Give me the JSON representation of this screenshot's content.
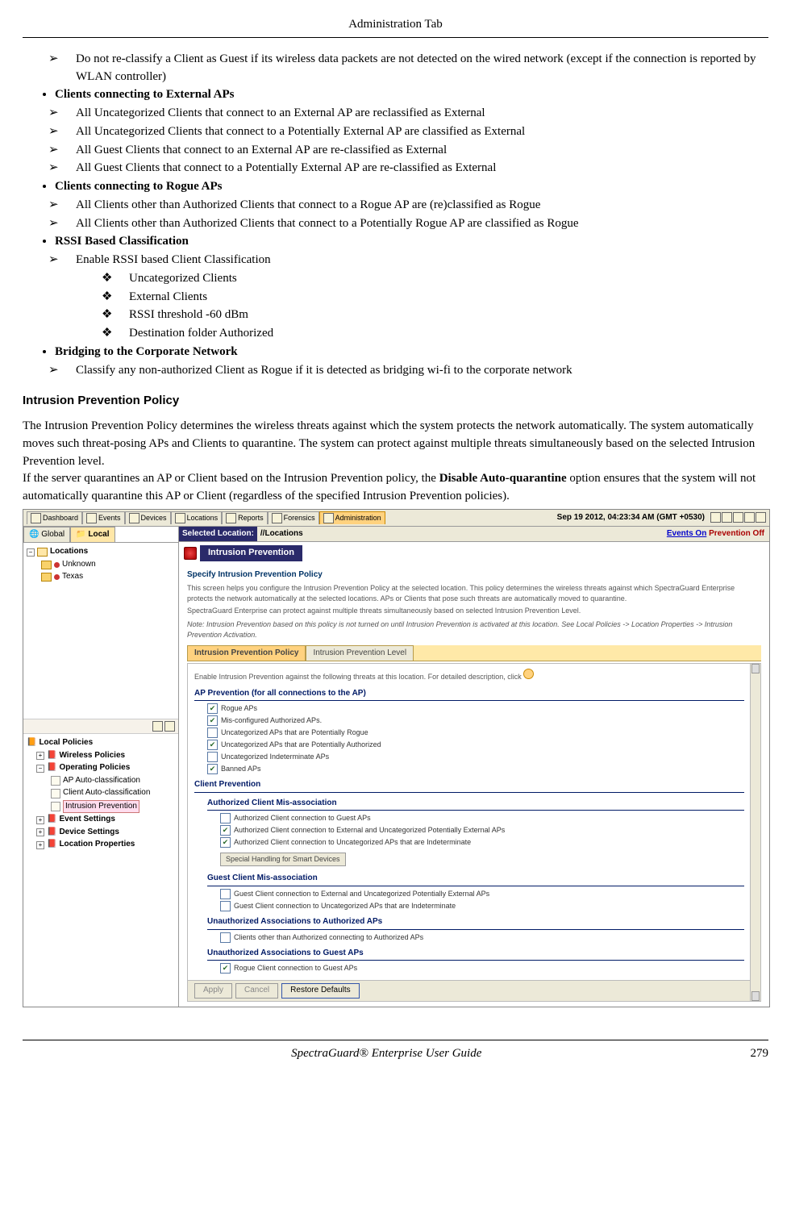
{
  "header": {
    "title": "Administration Tab"
  },
  "footer": {
    "book": "SpectraGuard® Enterprise User Guide",
    "page": "279"
  },
  "bullets": {
    "pre_chev": "Do not re-classify a Client as Guest if its wireless data packets are not detected on the wired network (except if the connection is reported by WLAN controller)",
    "ext_aps": {
      "title": "Clients connecting to External APs",
      "items": [
        "All Uncategorized Clients that connect to an External AP are reclassified as External",
        "All Uncategorized Clients that connect to a Potentially External AP are classified as External",
        "All Guest Clients that connect to an External AP are re-classified as External",
        "All Guest Clients that connect to a Potentially External AP are re-classified as External"
      ]
    },
    "rogue_aps": {
      "title": "Clients connecting to Rogue APs",
      "items": [
        "All Clients other than Authorized Clients that connect to a Rogue AP are (re)classified as Rogue",
        "All Clients other than Authorized Clients that connect to a Potentially Rogue AP are classified as Rogue"
      ]
    },
    "rssi": {
      "title": "RSSI Based Classification",
      "enable": "Enable RSSI based Client Classification",
      "sub": [
        "Uncategorized Clients",
        "External Clients",
        "RSSI threshold -60 dBm",
        "Destination folder Authorized"
      ]
    },
    "bridging": {
      "title": "Bridging to the Corporate Network",
      "item": "Classify any non-authorized Client as Rogue if it is detected as bridging wi-fi to the corporate network"
    }
  },
  "ipp_heading": "Intrusion Prevention Policy",
  "ipp_para1": "The Intrusion Prevention Policy determines the wireless threats against which the system protects the network automatically. The system automatically moves such threat-posing APs and Clients to quarantine. The system can protect against multiple threats simultaneously based on the selected Intrusion Prevention level.",
  "ipp_para2a": "If the server quarantines an AP or Client based on the Intrusion Prevention policy, the ",
  "ipp_para2_bold": "Disable Auto-quarantine",
  "ipp_para2b": " option ensures that the system will not automatically quarantine this AP or Client (regardless of the specified Intrusion Prevention policies).",
  "screenshot": {
    "top_tabs": [
      "Dashboard",
      "Events",
      "Devices",
      "Locations",
      "Reports",
      "Forensics",
      "Administration"
    ],
    "timestamp": "Sep 19 2012, 04:23:34 AM (GMT +0530)",
    "gl_tabs": [
      "Global",
      "Local"
    ],
    "tree": {
      "root": "Locations",
      "children": [
        "Unknown",
        "Texas"
      ]
    },
    "policies_title": "Local Policies",
    "policies": {
      "wireless": "Wireless Policies",
      "operating": "Operating Policies",
      "operating_children": [
        "AP Auto-classification",
        "Client Auto-classification",
        "Intrusion Prevention"
      ],
      "event": "Event Settings",
      "device": "Device Settings",
      "location": "Location Properties"
    },
    "selloc_label": "Selected Location:",
    "selloc_path": "//Locations",
    "events_link": "Events On",
    "prev_off": "Prevention Off",
    "panel_title": "Intrusion Prevention",
    "spec_title": "Specify Intrusion Prevention Policy",
    "hint1": "This screen helps you configure the Intrusion Prevention Policy at the selected location. This policy determines the wireless threats against which SpectraGuard Enterprise protects the network automatically at the selected locations. APs or Clients that pose such threats are automatically moved to quarantine.",
    "hint2": "SpectraGuard Enterprise can protect against multiple threats simultaneously based on selected Intrusion Prevention Level.",
    "note": "Note: Intrusion Prevention based on this policy is not turned on until Intrusion Prevention is activated at this location. See Local Policies -> Location Properties -> Intrusion Prevention Activation.",
    "inner_tabs": [
      "Intrusion Prevention Policy",
      "Intrusion Prevention Level"
    ],
    "enable_line_a": "Enable Intrusion Prevention against the following threats at this location. For detailed description, click",
    "ap_prev_title": "AP Prevention (for all connections to the AP)",
    "ap_prev": [
      {
        "label": "Rogue APs",
        "checked": true
      },
      {
        "label": "Mis-configured Authorized APs.",
        "checked": true
      },
      {
        "label": "Uncategorized APs that are Potentially Rogue",
        "checked": false
      },
      {
        "label": "Uncategorized APs that are Potentially Authorized",
        "checked": true
      },
      {
        "label": "Uncategorized Indeterminate APs",
        "checked": false
      },
      {
        "label": "Banned APs",
        "checked": true
      }
    ],
    "client_prev_title": "Client Prevention",
    "auth_mis_title": "Authorized Client Mis-association",
    "auth_mis": [
      {
        "label": "Authorized Client connection to Guest APs",
        "checked": false
      },
      {
        "label": "Authorized Client connection to External and Uncategorized Potentially External APs",
        "checked": true
      },
      {
        "label": "Authorized Client connection to Uncategorized APs that are Indeterminate",
        "checked": true
      }
    ],
    "smart_btn": "Special Handling for Smart Devices",
    "guest_mis_title": "Guest Client Mis-association",
    "guest_mis": [
      {
        "label": "Guest Client connection to External and Uncategorized Potentially External APs",
        "checked": false
      },
      {
        "label": "Guest Client connection to Uncategorized APs that are Indeterminate",
        "checked": false
      }
    ],
    "unauth_auth_title": "Unauthorized Associations to Authorized APs",
    "unauth_auth": [
      {
        "label": "Clients other than Authorized connecting to Authorized APs",
        "checked": false
      }
    ],
    "unauth_guest_title": "Unauthorized Associations to Guest APs",
    "unauth_guest": [
      {
        "label": "Rogue Client connection to Guest APs",
        "checked": true
      }
    ],
    "buttons": {
      "apply": "Apply",
      "cancel": "Cancel",
      "restore": "Restore Defaults"
    }
  }
}
